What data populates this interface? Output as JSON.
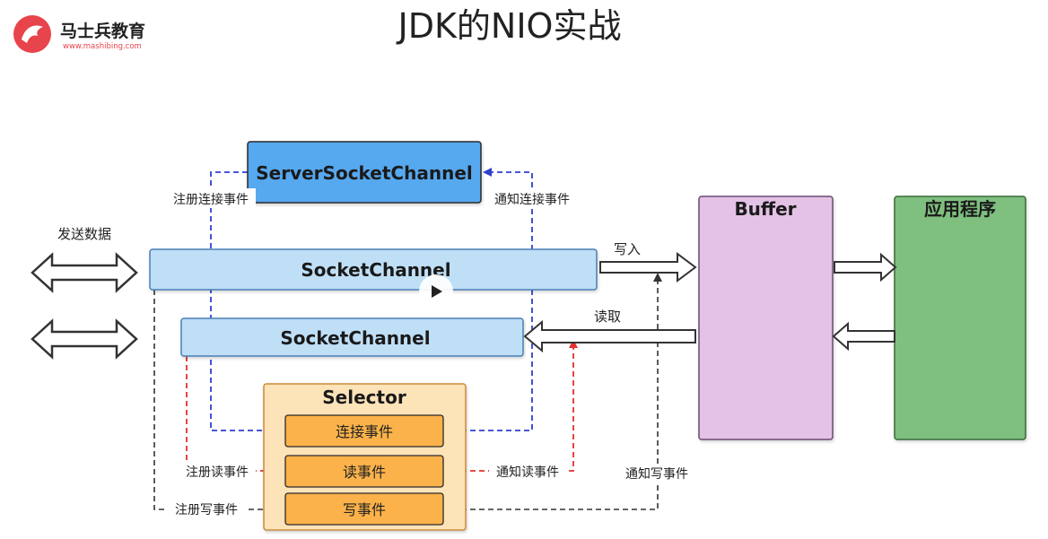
{
  "header": {
    "title": "JDK的NIO实战",
    "brand_name": "马士兵教育",
    "brand_url": "www.mashibing.com"
  },
  "nodes": {
    "server_socket_channel": "ServerSocketChannel",
    "socket_channel_1": "SocketChannel",
    "socket_channel_2": "SocketChannel",
    "selector": "Selector",
    "connect_event": "连接事件",
    "read_event": "读事件",
    "write_event": "写事件",
    "buffer": "Buffer",
    "application": "应用程序"
  },
  "labels": {
    "send_data": "发送数据",
    "register_connect": "注册连接事件",
    "notify_connect": "通知连接事件",
    "write_in": "写入",
    "read_out": "读取",
    "register_read": "注册读事件",
    "notify_read": "通知读事件",
    "notify_write": "通知写事件",
    "register_write": "注册写事件"
  },
  "colors": {
    "server_channel_fill": "#56a8ef",
    "socket_channel_fill": "#bfdff7",
    "selector_fill": "#fde3b8",
    "event_fill": "#fbb24a",
    "buffer_fill": "#e3c2e6",
    "app_fill": "#7fbf7f",
    "connect_line": "#2f3fd0",
    "read_line": "#e53030",
    "write_line": "#333333",
    "brand_red": "#e8444c"
  }
}
